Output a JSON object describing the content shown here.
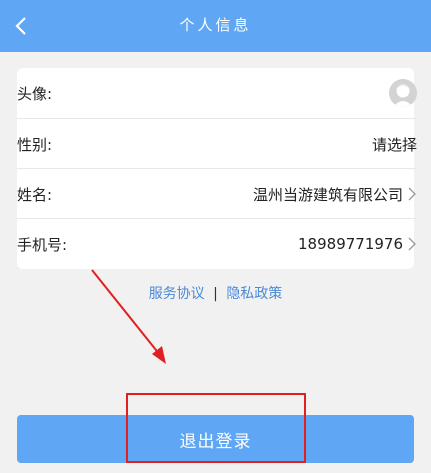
{
  "header": {
    "title": "个人信息",
    "back_icon": "chevron-left-icon"
  },
  "profile": {
    "rows": [
      {
        "label": "头像:",
        "value": "",
        "type": "avatar"
      },
      {
        "label": "性别:",
        "value": "请选择",
        "type": "select"
      },
      {
        "label": "姓名:",
        "value": "温州当游建筑有限公司",
        "type": "link"
      },
      {
        "label": "手机号:",
        "value": "18989771976",
        "type": "link"
      }
    ]
  },
  "links": {
    "service": "服务协议",
    "separator": "|",
    "privacy": "隐私政策"
  },
  "logout": {
    "label": "退出登录"
  },
  "colors": {
    "accent": "#5fa6f4",
    "link": "#4a8ad8",
    "annotation": "#e02020"
  }
}
